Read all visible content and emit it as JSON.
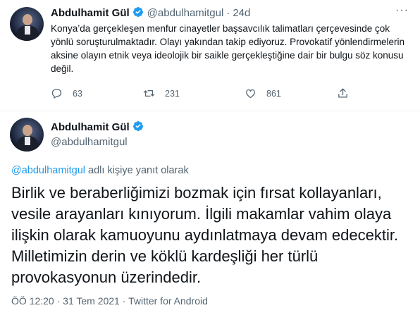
{
  "tweet1": {
    "author": "Abdulhamit Gül",
    "handle": "@abdulhamitgul",
    "separator": "·",
    "time": "24d",
    "more": "···",
    "text": "Konya’da gerçekleşen menfur cinayetler başsavcılık talimatları çerçevesinde çok yönlü soruşturulmaktadır. Olayı yakından takip ediyoruz. Provokatif yönlendirmelerin aksine olayın etnik veya ideolojik bir saikle gerçekleştiğine dair bir bulgu söz konusu değil.",
    "replies": "63",
    "retweets": "231",
    "likes": "861"
  },
  "tweet2": {
    "author": "Abdulhamit Gül",
    "handle": "@abdulhamitgul",
    "reply_mention": "@abdulhamitgul",
    "reply_suffix": " adlı kişiye yanıt olarak",
    "text": "Birlik ve beraberliğimizi bozmak için fırsat kollayanları, vesile arayanları kınıyorum. İlgili makamlar vahim olaya ilişkin olarak kamuoyunu aydınlatmaya devam edecektir. Milletimizin derin ve köklü kardeşliği her türlü provokasyonun üzerindedir.",
    "time": "ÖÖ 12:20",
    "dot": "·",
    "date": "31 Tem 2021",
    "source": "Twitter for Android"
  },
  "colors": {
    "verified": "#1d9bf0",
    "muted": "#536471",
    "link": "#1d9bf0"
  },
  "icons": {
    "reply": "reply-icon",
    "retweet": "retweet-icon",
    "like": "heart-icon",
    "share": "share-icon",
    "verified": "verified-badge-icon"
  }
}
